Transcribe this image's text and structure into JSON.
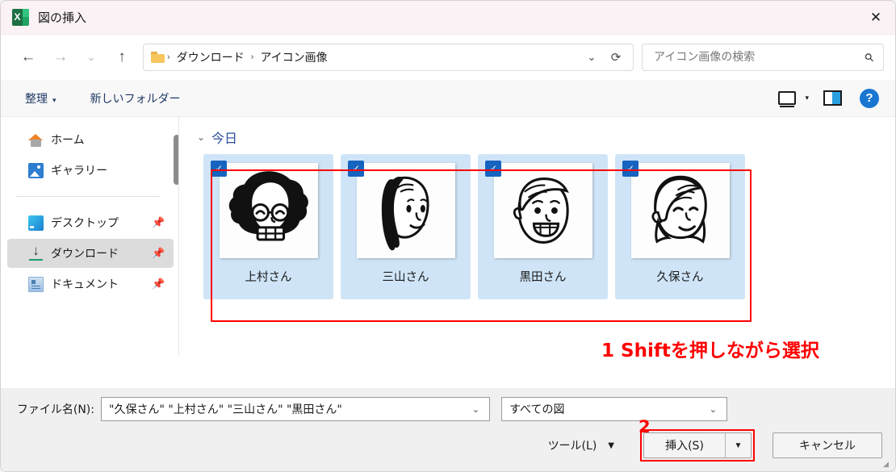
{
  "window": {
    "title": "図の挿入",
    "app_icon": "excel-icon",
    "close_label": "✕"
  },
  "nav": {
    "back": "←",
    "forward": "→",
    "recent": "⌄",
    "up": "↑",
    "breadcrumb": [
      "ダウンロード",
      "アイコン画像"
    ],
    "dropdown": "⌄",
    "refresh": "⟳"
  },
  "search": {
    "placeholder": "アイコン画像の検索",
    "value": "",
    "icon": "search-icon"
  },
  "toolbar": {
    "organize": "整理",
    "new_folder": "新しいフォルダー",
    "caret": "▾",
    "help": "?"
  },
  "sidebar": {
    "items": [
      {
        "label": "ホーム",
        "icon": "home-icon",
        "pinned": false,
        "selected": false
      },
      {
        "label": "ギャラリー",
        "icon": "gallery-icon",
        "pinned": false,
        "selected": false
      },
      {
        "label": "デスクトップ",
        "icon": "desktop-icon",
        "pinned": true,
        "selected": false
      },
      {
        "label": "ダウンロード",
        "icon": "download-icon",
        "pinned": true,
        "selected": true
      },
      {
        "label": "ドキュメント",
        "icon": "document-icon",
        "pinned": true,
        "selected": false
      }
    ],
    "pin_glyph": "📌"
  },
  "files": {
    "group_label": "今日",
    "group_chevron": "⌄",
    "check_glyph": "✓",
    "items": [
      {
        "name": "上村さん",
        "selected": true,
        "avatar": "afro-glasses-face"
      },
      {
        "name": "三山さん",
        "selected": true,
        "avatar": "ponytail-face"
      },
      {
        "name": "黒田さん",
        "selected": true,
        "avatar": "short-hair-face"
      },
      {
        "name": "久保さん",
        "selected": true,
        "avatar": "long-hair-face"
      }
    ]
  },
  "annotations": [
    {
      "id": "step-1",
      "text": "1 Shiftを押しながら選択",
      "color": "#ff0000"
    },
    {
      "id": "step-2",
      "text": "2",
      "color": "#ff0000"
    }
  ],
  "footer": {
    "filename_label": "ファイル名(N):",
    "filename_value": "\"久保さん\" \"上村さん\" \"三山さん\" \"黒田さん\"",
    "filetype_value": "すべての図",
    "chevron": "⌄",
    "tools_label": "ツール(L)",
    "tools_caret": "▼",
    "insert_label": "挿入(S)",
    "insert_caret": "▼",
    "cancel_label": "キャンセル"
  }
}
